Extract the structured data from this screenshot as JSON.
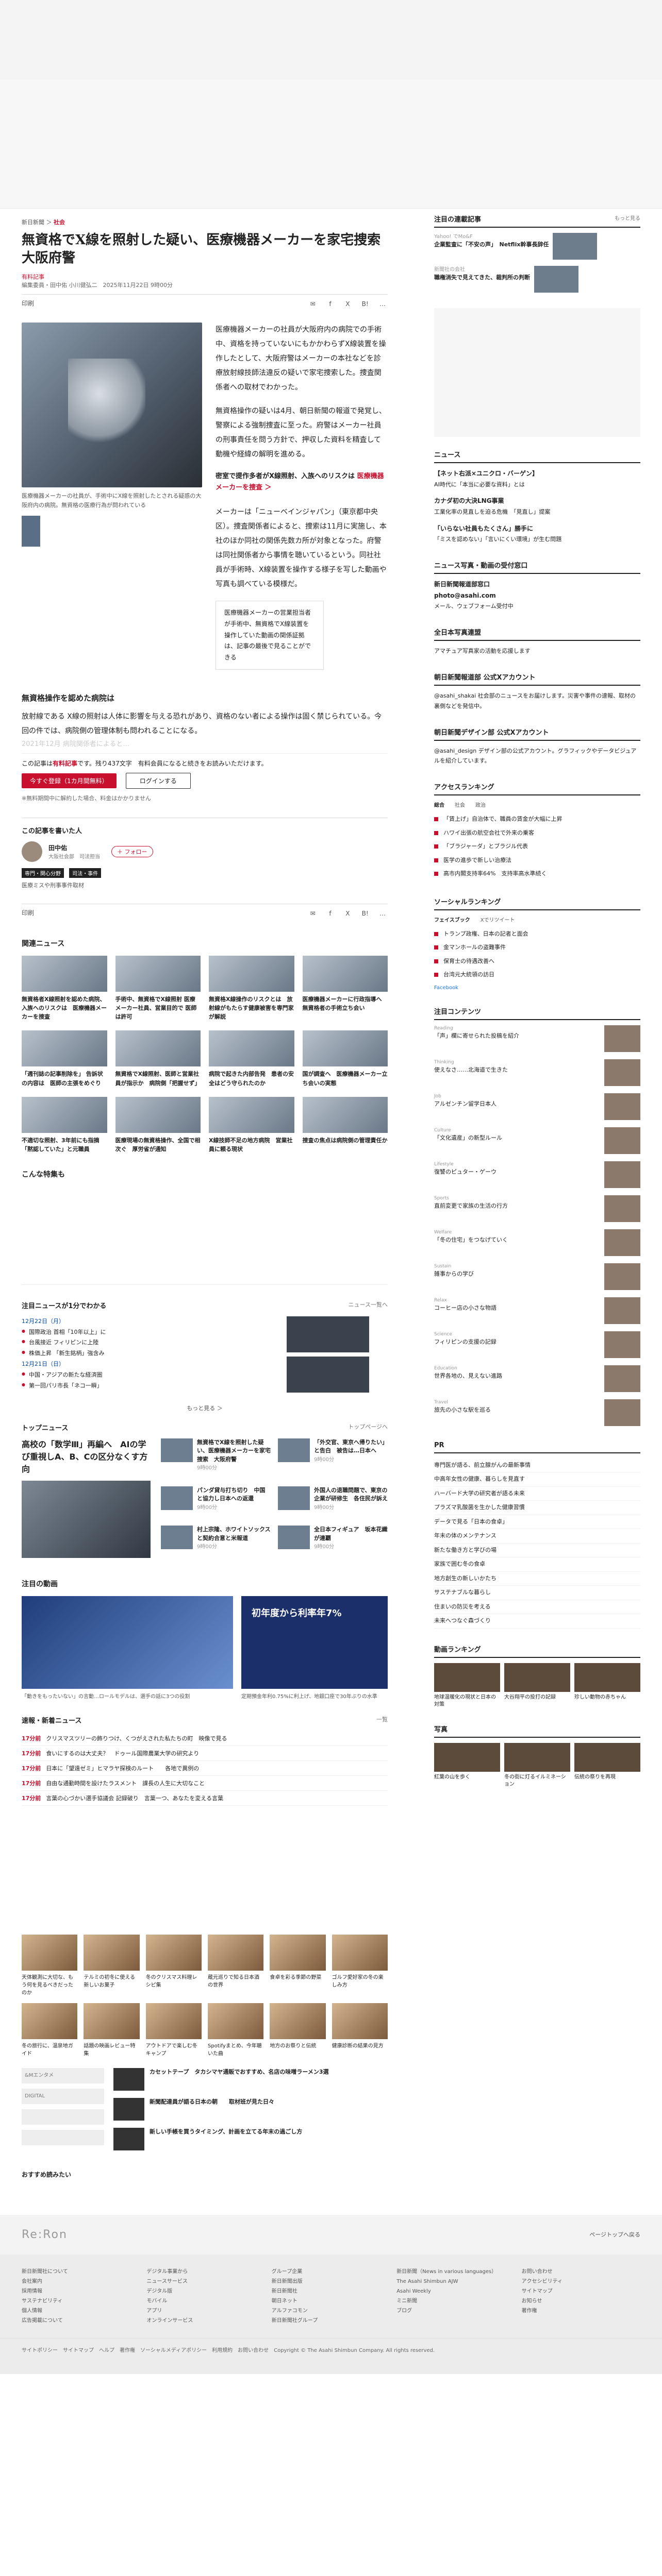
{
  "breadcrumb": {
    "home": "新日新聞",
    "sep": "＞",
    "category": "社会"
  },
  "article": {
    "title": "無資格でX線を照射した疑い、医療機器メーカーを家宅捜索　大阪府警",
    "tag": "有料記事",
    "byline": "編集委員・田中佑 小川健弘二　2025年11月22日 9時00分",
    "caption": "医療機器メーカーの社員が、手術中にX線を照射したとされる疑惑の大阪府内の病院。無資格の医療行為が問われている",
    "paragraphs": [
      "医療機器メーカーの社員が大阪府内の病院での手術中、資格を持っていないにもかかわらずX線装置を操作したとして、大阪府警はメーカーの本社などを診療放射線技師法違反の疑いで家宅捜索した。捜査関係者への取材でわかった。",
      "無資格操作の疑いは4月、朝日新聞の報道で発覚し、警察による強制捜査に至った。府警はメーカー社員の刑事責任を問う方針で、押収した資料を精査して動機や経緯の解明を進める。"
    ],
    "related_prefix": "密室で提作多者がX線照射、入族へのリスクは",
    "related_link": "医療機器メーカーを捜査 ＞",
    "paragraph3": "メーカーは「ニューベインジャパン」（東京都中央区）。捜査関係者によると、捜索は11月に実施し、本社のほか同社の関係先数カ所が対象となった。府警は同社関係者から事情を聴いているという。同社社員が手術時、X線装置を操作する様子を写した動画や写真も調べている模様だ。",
    "quote": "医療機器メーカーの営業担当者が手術中、無資格でX線装置を操作していた動画の関係証拠は、記事の最後で見ることができる",
    "subheading": "無資格操作を認めた病院は",
    "paragraph4": "放射線である X線の照射は人体に影響を与える恐れがあり、資格のない者による操作は固く禁じられている。今回の件では、病院側の管理体制も問われることになる。",
    "faded": "2021年12月 病院関係者によると…",
    "paywall_note_pre": "この記事は",
    "paywall_note_hl": "有料記事",
    "paywall_note_post": "です。残り437文字　有料会員になると続きをお読みいただけます。",
    "subscribe_btn": "今すぐ登録（1カ月間無料）",
    "login_btn": "ログインする",
    "small_note": "※無料期間中に解約した場合、料金はかかりません"
  },
  "toolbar": {
    "print": "印刷",
    "mail": "✉",
    "fb": "f",
    "x": "X",
    "hatena": "B!",
    "more": "…"
  },
  "author": {
    "box_title": "この記事を書いた人",
    "name": "田中佑",
    "org": "大阪社会部　司法担当",
    "follow": "＋ フォロー",
    "badge1": "専門・関心分野",
    "badge2": "司法・事件",
    "sub": "医療ミスや刑事事件取材"
  },
  "related": {
    "title": "関連ニュース",
    "items": [
      "無資格者X線照射を認めた病院、入族へのリスクは　医療機器メーカーを捜査",
      "手術中、無資格でX線照射 医療メーカー社員、営業目的で 医師は許可",
      "無資格X線操作のリスクとは　放射線がもたらす健康被害を専門家が解説",
      "医療機器メーカーに行政指導へ　無資格者の手術立ち会い"
    ],
    "items2": [
      "「週刊誌の記事削除を」 告訴状の内容は　医師の主張をめぐり",
      "無資格でX線照射、医師と営業社員が指示か　病院側「把握せず」",
      "病院で起きた内部告発　患者の安全はどう守られたのか",
      "国が調査へ　医療機器メーカー立ち会いの実態"
    ],
    "items3": [
      "不適切な照射、3年前にも指摘　「黙認していた」と元職員",
      "医療現場の無資格操作、全国で相次ぐ　厚労省が通知",
      "X線技師不足の地方病院　営業社員に頼る現状",
      "捜査の焦点は病院側の管理責任か"
    ],
    "feature_title": "こんな特集も"
  },
  "week": {
    "title": "注目ニュースが1分でわかる",
    "more": "ニュース一覧へ",
    "date1": "12月22日（月）",
    "items1": [
      "国際政治 首相「10年以上」に",
      "台風接近 フィリピンに上陸",
      "株価上昇 「新生銘柄」強含み"
    ],
    "date2": "12月21日（日）",
    "items2": [
      "中国・アジアの新たな経済圏",
      "第一回パリ市長「ネコ一瞬」"
    ],
    "btn": "もっと見る ＞"
  },
  "topnews": {
    "title": "トップニュース",
    "more": "トップページへ",
    "lead": "高校の「数学Ⅲ」再編へ　AIの学び重視しA、B、Cの区分なくす方向",
    "items": [
      {
        "t": "無資格でX線を照射した疑い、医療機器メーカーを家宅捜索　大阪府警",
        "m": "9時00分"
      },
      {
        "t": "「外交官、東京へ帰りたい」と告白　被告は…日本へ",
        "m": "9時00分"
      },
      {
        "t": "パンダ貸与打ち切り　中国と協力し日本への返還",
        "m": "9時00分"
      },
      {
        "t": "外国人の退職問題で、東京の企業が研修生　各住民が訴え",
        "m": "9時00分"
      },
      {
        "t": "村上宗隆、ホワイトソックスと契約合意と米報道",
        "m": "9時00分"
      },
      {
        "t": "全日本フィギュア　坂本花織が連覇",
        "m": "9時00分"
      }
    ]
  },
  "hot": {
    "title": "注目の動画",
    "ad_text": "初年度から利率年7%",
    "cap1": "「動きをもったいない」の言動…ロールモデルは、選手の話に3つの役割",
    "cap2": "定期預金年利0.75%に利上げ、地銀口座で30年ぶりの水準"
  },
  "latest": {
    "title": "速報・新着ニュース",
    "more": "一覧",
    "items": [
      {
        "time": "17分前",
        "t": "クリスマスツリーの飾りつけ、くつがえされた私たちの町　映像で見る"
      },
      {
        "time": "17分前",
        "t": "食いにするのは大丈夫？　ドゥール国際農業大学の研究より"
      },
      {
        "time": "17分前",
        "t": "日本に「望遠ゼミ」ヒマラヤ探検のルート　　各地で異例の"
      },
      {
        "time": "17分前",
        "t": "自由な通勤時間を設けたラスメント　課長の人生に大切なこと"
      },
      {
        "time": "17分前",
        "t": "言葉の心づかい選手協議会 記録破り　言葉一つ、あなたを変える言葉"
      }
    ]
  },
  "gallery": {
    "items": [
      "天体観測に大切な、もう何を見るべきだったのか",
      "テルミの初冬に使える新しいお菓子",
      "冬のクリスマス料理レシピ集",
      "蔵元巡りで知る日本酒の世界",
      "食卓を彩る季節の野菜",
      "ゴルフ愛好家の冬の楽しみ方",
      "冬の旅行に、温泉地ガイド",
      "話題の映画レビュー特集",
      "アウトドアで楽しむ冬キャンプ",
      "Spotifyまとめ、今年聴いた曲",
      "地方のお祭りと伝統",
      "健康診断の結果の見方"
    ]
  },
  "promo": {
    "labels": [
      "&Mエンタメ",
      "DIGITAL"
    ],
    "items": [
      {
        "t": "カセットテープ　タカシマヤ通販でおすすめ、名店の味噌ラーメン3選"
      },
      {
        "t": "新聞配達員が語る日本の朝　　取材班が見た日々"
      },
      {
        "t": "新しい手帳を買うタイミング、計画を立てる年末の過ごし方"
      }
    ],
    "more": "おすすめ読みたい"
  },
  "sidebar": {
    "hot_title": "注目の連載記事",
    "hot_more": "もっと見る",
    "hot_items": [
      {
        "cat": "Yahoo! でMo&F",
        "t": "企業監査に「不安の声」　Netflix幹事長辞任"
      },
      {
        "cat": "新聞社の会社",
        "t": "職権消失で見えてきた、裁判所の判断"
      }
    ],
    "press_title": "ニュース",
    "press_items": [
      {
        "b": "【ネット右派×ユニクロ・バーゲン】",
        "t": "AI時代に「本当に必要な資料」とは"
      },
      {
        "b": "カナダ初の大決LNG事業",
        "t": "工業化率の見直しを迫る危機　「見直し」提案"
      },
      {
        "b": "「いらない社員もたくさん」勝手に",
        "t": "「ミスを認めない」「言いにくい環境」が生む問題"
      }
    ],
    "news_title": "ニュース写真・動画の受付窓口",
    "news_lines": [
      "新日新聞報道部窓口",
      "photo@asahi.com",
      "メール、ウェブフォーム受付中"
    ],
    "share_title": "全日本写真連盟",
    "share_desc": "アマチュア写真家の活動を応援します",
    "acct1_title": "朝日新聞報道部 公式Xアカウント",
    "acct1_desc": "@asahi_shakai 社会部のニュースをお届けします。災害や事件の速報、取材の裏側などを発信中。",
    "acct2_title": "朝日新聞デザイン部 公式Xアカウント",
    "acct2_desc": "@asahi_design デザイン部の公式アカウント。グラフィックやデータビジュアルを紹介しています。",
    "rank_title": "アクセスランキング",
    "rank_tabs": [
      "総合",
      "社会",
      "政治"
    ],
    "rank_items": [
      "「賃上げ」自治体で、職員の賃金が大幅に上昇",
      "ハワイ出張の航空会社で外来の乗客",
      "「ブラジャーダ」とブラジル代表",
      "医学の進歩で新しい治療法",
      "高市内閣支持率64%　支持率高水準続く"
    ],
    "social_title": "ソーシャルランキング",
    "social_tabs": [
      "フェイスブック",
      "Xでリツイート"
    ],
    "social_items": [
      "トランプ政権、日本の記者と面会",
      "金マンホールの盗難事件",
      "保育士の待遇改善へ",
      "台湾元大統領の訪日"
    ],
    "social_more": "Facebook",
    "content_title": "注目コンテンツ",
    "contents": [
      {
        "s": "Reading",
        "t": "「声」欄に寄せられた投稿を紹介"
      },
      {
        "s": "Thinking",
        "t": "使えなさ……北海道で生きた"
      },
      {
        "s": "Job",
        "t": "アルゼンチン留学日本人"
      },
      {
        "s": "Culture",
        "t": "「文化遺産」の新型ルール"
      },
      {
        "s": "Lifestyle",
        "t": "復讐のピュター・ゲーウ"
      },
      {
        "s": "Sports",
        "t": "直前変更で家族の生活の行方"
      },
      {
        "s": "Welfare",
        "t": "「冬の住宅」をつなげていく"
      },
      {
        "s": "Sustain",
        "t": "雑事からの学び"
      },
      {
        "s": "Relax",
        "t": "コーヒー店の小さな物語"
      },
      {
        "s": "Science",
        "t": "フィリピンの支援の記録"
      },
      {
        "s": "Education",
        "t": "世界各地の、見えない進路"
      },
      {
        "s": "Travel",
        "t": "旅先の小さな駅を巡る"
      }
    ],
    "pr_title": "PR",
    "pr_items": [
      "専門医が語る、前立腺がんの最新事情",
      "中高年女性の健康、暮らしを見直す",
      "ハーバード大学の研究者が語る未来",
      "プラズマ乳酸菌を生かした健康習慣",
      "データで見る「日本の食卓」",
      "年末の体のメンテナンス",
      "新たな働き方と学びの場",
      "家族で囲む冬の食卓",
      "地方創生の新しいかたち",
      "サステナブルな暮らし",
      "住まいの防災を考える",
      "未来へつなぐ森づくり"
    ],
    "video_title": "動画ランキング",
    "videos": [
      "地球温暖化の現状と日本の対策",
      "大谷翔平の投打の記録",
      "珍しい動物の赤ちゃん"
    ],
    "photo_title": "写真",
    "photos": [
      "紅葉の山を歩く",
      "冬の街に灯るイルミネーション",
      "伝統の祭りを再現"
    ]
  },
  "footer": {
    "pagetop": "ページトップへ戻る",
    "logo": "Re:Ron",
    "cols": [
      [
        "新日新聞社について",
        "会社案内",
        "採用情報",
        "サステナビリティ",
        "個人情報",
        "広告掲載について"
      ],
      [
        "デジタル事業から",
        "ニュースサービス",
        "デジタル版",
        "モバイル",
        "アプリ",
        "オンラインサービス"
      ],
      [
        "グループ企業",
        "新日新聞出版",
        "新日新聞社",
        "朝日ネット",
        "アルファコモン",
        "新日新聞社グループ"
      ],
      [
        "新日新聞（News in various languages）",
        "The Asahi Shimbun AJW",
        "Asahi Weekly",
        "ミニ新聞",
        "ブログ"
      ],
      [
        "お問い合わせ",
        "アクセシビリティ",
        "サイトマップ",
        "お知らせ",
        "著作権"
      ]
    ],
    "bottom": "サイトポリシー　サイトマップ　ヘルプ　著作権　ソーシャルメディアポリシー　利用規約　お問い合わせ　Copyright © The Asahi Shimbun Company. All rights reserved."
  }
}
